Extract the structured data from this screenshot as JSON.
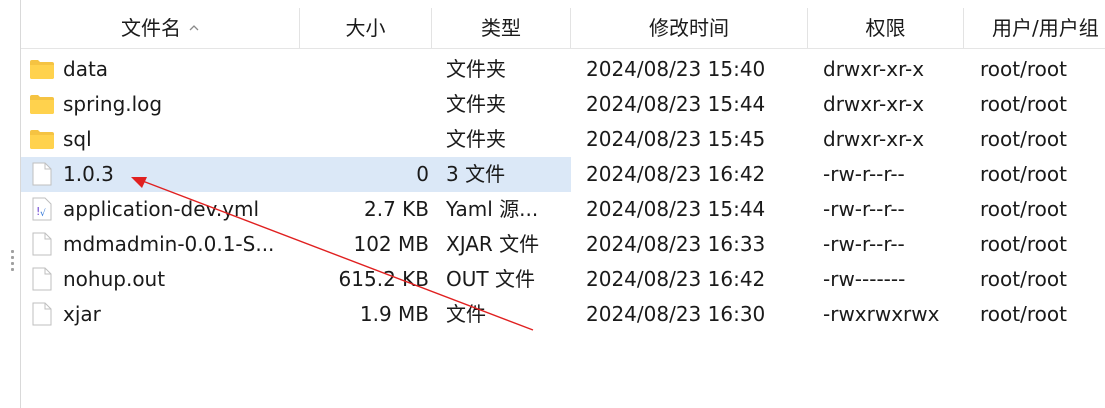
{
  "columns": {
    "name": "文件名",
    "size": "大小",
    "type": "类型",
    "modified": "修改时间",
    "permissions": "权限",
    "owner": "用户/用户组"
  },
  "files": [
    {
      "name": "data",
      "size": "",
      "type": "文件夹",
      "modified": "2024/08/23 15:40",
      "permissions": "drwxr-xr-x",
      "owner": "root/root",
      "icon": "folder-icon"
    },
    {
      "name": "spring.log",
      "size": "",
      "type": "文件夹",
      "modified": "2024/08/23 15:44",
      "permissions": "drwxr-xr-x",
      "owner": "root/root",
      "icon": "folder-icon"
    },
    {
      "name": "sql",
      "size": "",
      "type": "文件夹",
      "modified": "2024/08/23 15:45",
      "permissions": "drwxr-xr-x",
      "owner": "root/root",
      "icon": "folder-icon"
    },
    {
      "name": "1.0.3",
      "size": "0",
      "type": "3 文件",
      "modified": "2024/08/23 16:42",
      "permissions": "-rw-r--r--",
      "owner": "root/root",
      "icon": "file-icon"
    },
    {
      "name": "application-dev.yml",
      "size": "2.7 KB",
      "type": "Yaml 源...",
      "modified": "2024/08/23 15:44",
      "permissions": "-rw-r--r--",
      "owner": "root/root",
      "icon": "yaml-file-icon"
    },
    {
      "name": "mdmadmin-0.0.1-S...",
      "size": "102 MB",
      "type": "XJAR 文件",
      "modified": "2024/08/23 16:33",
      "permissions": "-rw-r--r--",
      "owner": "root/root",
      "icon": "file-icon"
    },
    {
      "name": "nohup.out",
      "size": "615.2 KB",
      "type": "OUT 文件",
      "modified": "2024/08/23 16:42",
      "permissions": "-rw-------",
      "owner": "root/root",
      "icon": "file-icon"
    },
    {
      "name": "xjar",
      "size": "1.9 MB",
      "type": "文件",
      "modified": "2024/08/23 16:30",
      "permissions": "-rwxrwxrwx",
      "owner": "root/root",
      "icon": "file-icon"
    }
  ],
  "selected_row": 3,
  "colors": {
    "selection": "#dbe8f7",
    "folder": "#f5c342",
    "arrow": "#e02020"
  }
}
